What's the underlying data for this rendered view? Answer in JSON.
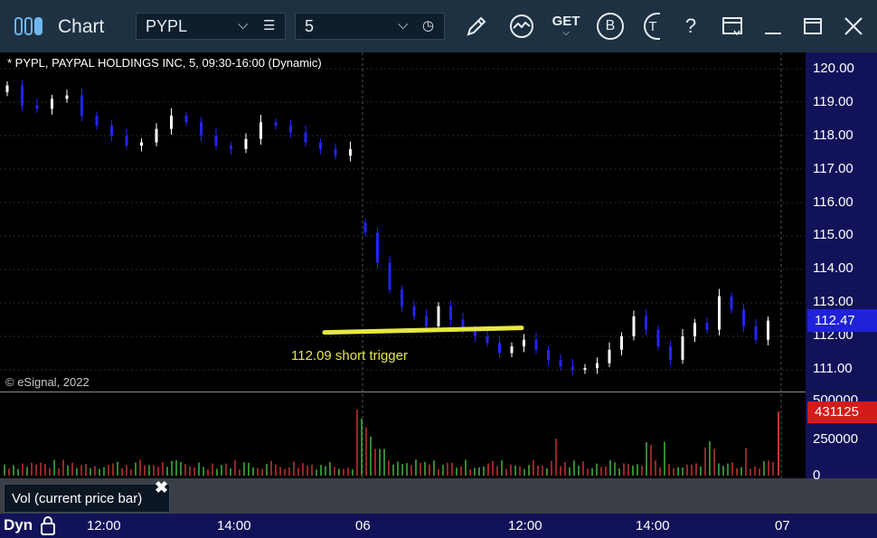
{
  "window": {
    "title": "Chart",
    "symbol": "PYPL",
    "interval": "5",
    "toolbar_icons": [
      "chart-type-icon",
      "symbol-dropdown-icon",
      "symbol-list-icon",
      "interval-dropdown-icon",
      "clock-icon",
      "draw-pencil-icon",
      "studies-icon",
      "get-icon",
      "b-icon",
      "t-icon",
      "help-icon",
      "layout-icon",
      "minimize-icon",
      "maximize-icon",
      "close-icon"
    ],
    "toolbar_text": {
      "get": "GET",
      "b": "B",
      "t": "T",
      "help": "?"
    }
  },
  "chart": {
    "legend": "* PYPL, PAYPAL HOLDINGS INC, 5, 09:30-16:00 (Dynamic)",
    "copyright": "© eSignal, 2022",
    "annotation": "112.09 short trigger",
    "last_price": "112.47",
    "last_volume": "431125",
    "volume_label": "Vol (current price bar)",
    "volume_close": "✖",
    "session_mode": "Dyn",
    "price_axis_labels": [
      "120.00",
      "119.00",
      "118.00",
      "117.00",
      "116.00",
      "115.00",
      "114.00",
      "113.00",
      "112.00",
      "111.00"
    ],
    "volume_axis_labels": [
      "500000",
      "250000",
      "0"
    ],
    "time_axis_labels": [
      "12:00",
      "14:00",
      "06",
      "12:00",
      "14:00",
      "07"
    ],
    "colors": {
      "background": "#000000",
      "up": "#ffffff",
      "down": "#2323ff",
      "price_box": "#1f22d8",
      "volume_box": "#d41a1a",
      "axis_bg": "#12125a",
      "trendline": "#e6e840",
      "vol_up": "#42b642",
      "vol_down": "#c83232"
    }
  },
  "chart_data": {
    "type": "candlestick",
    "y_range": [
      110.5,
      120.5
    ],
    "closes_day1": [
      119.5,
      118.9,
      118.8,
      119.1,
      119.2,
      118.6,
      118.3,
      118.0,
      117.7,
      117.8,
      118.2,
      118.6,
      118.4,
      118.0,
      117.7,
      117.6,
      117.9,
      118.4,
      118.3,
      118.1,
      117.8,
      117.6,
      117.4,
      117.6
    ],
    "closes_day2": [
      115.1,
      114.2,
      113.4,
      112.9,
      112.6,
      112.3,
      112.9,
      112.5,
      112.2,
      112.0,
      111.8,
      111.5,
      111.7,
      111.9,
      111.6,
      111.3,
      111.1,
      111.0,
      111.05,
      111.2,
      111.6,
      112.0,
      112.6,
      112.2,
      111.7,
      111.3,
      112.0,
      112.4,
      112.2,
      113.2,
      112.8,
      112.3,
      111.9,
      112.47
    ],
    "trendline": {
      "price": 112.09
    },
    "volume_last": 431125,
    "volume_range": [
      0,
      500000
    ]
  }
}
